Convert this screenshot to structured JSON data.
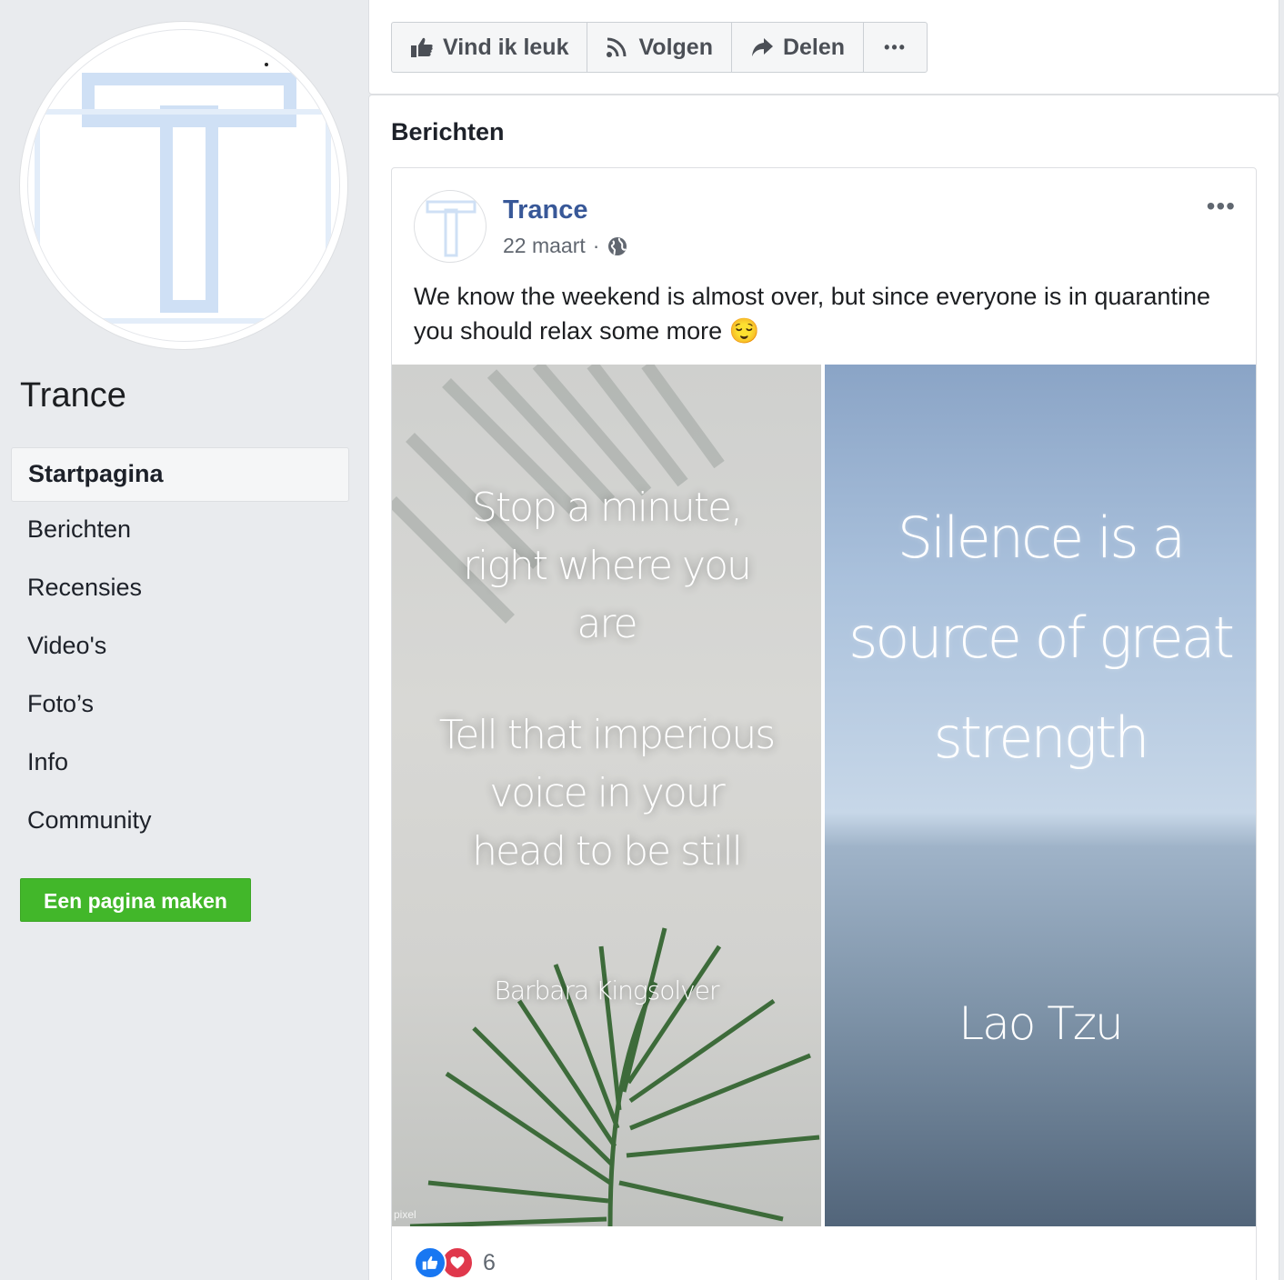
{
  "sidebar": {
    "page_name": "Trance",
    "nav": [
      {
        "label": "Startpagina",
        "active": true
      },
      {
        "label": "Berichten"
      },
      {
        "label": "Recensies"
      },
      {
        "label": "Video's"
      },
      {
        "label": "Foto’s"
      },
      {
        "label": "Info"
      },
      {
        "label": "Community"
      }
    ],
    "create_page_label": "Een pagina maken"
  },
  "actions": {
    "like_label": "Vind ik leuk",
    "follow_label": "Volgen",
    "share_label": "Delen",
    "more_label": "•••"
  },
  "posts": {
    "heading": "Berichten",
    "post": {
      "author": "Trance",
      "date": "22 maart",
      "separator": "·",
      "more_label": "•••",
      "text": "We know the weekend is almost over, but since everyone is in quarantine you should relax some more 😌",
      "photos": {
        "left": {
          "quote_1": [
            "Stop a minute,",
            "right where you",
            "are"
          ],
          "quote_2": [
            "Tell that imperious",
            "voice in your",
            "head to be still"
          ],
          "author": "Barbara Kingsolver",
          "watermark": "pixel"
        },
        "right": {
          "quote": [
            "Silence is a",
            "source of great",
            "strength"
          ],
          "author": "Lao Tzu"
        }
      },
      "reaction_count": "6"
    }
  },
  "colors": {
    "background": "#e9ebee",
    "link_blue": "#385898",
    "create_green": "#42b72a",
    "like_blue": "#1877f2",
    "love_red": "#e0384c"
  }
}
